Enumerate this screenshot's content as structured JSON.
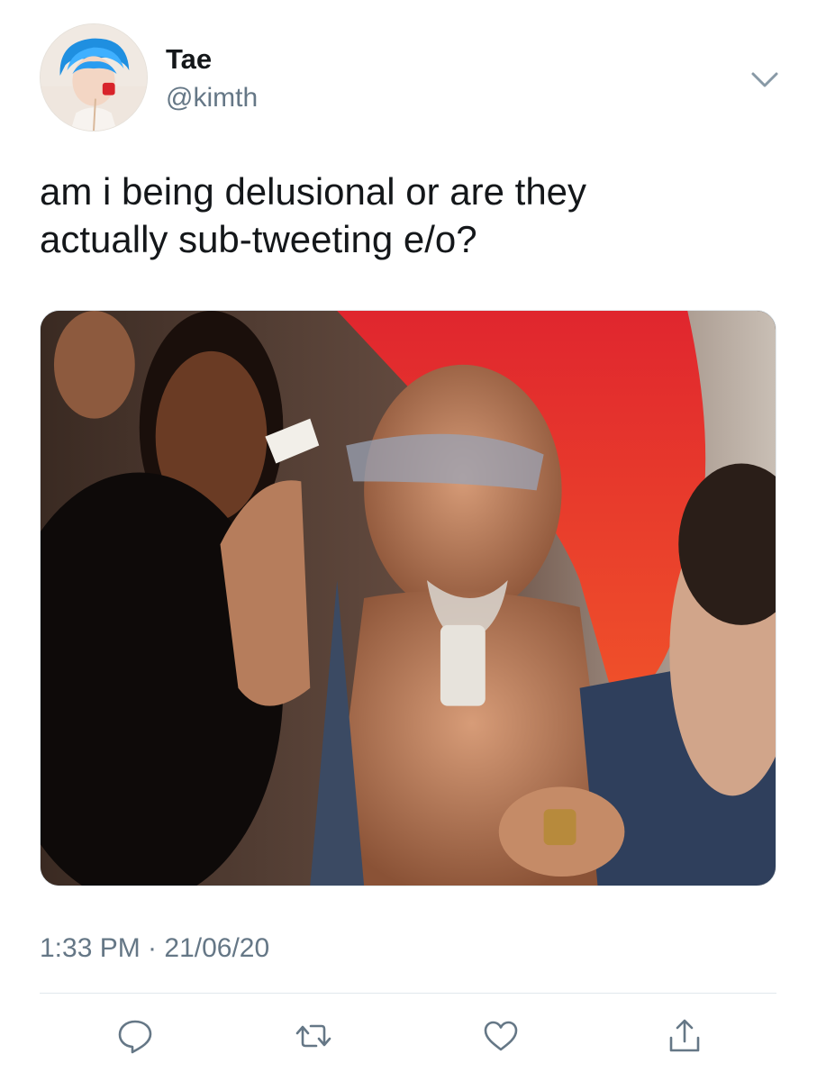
{
  "user": {
    "display_name": "Tae",
    "handle": "@kimth",
    "avatar_icon": "profile-photo"
  },
  "tweet": {
    "text_lines": [
      "am i being delusional or are they",
      "actually sub-tweeting e/o?"
    ],
    "timestamp": "1:33 PM · 21/06/20"
  },
  "actions": [
    {
      "name": "reply",
      "icon": "speech-bubble-icon"
    },
    {
      "name": "retweet",
      "icon": "retweet-arrows-icon"
    },
    {
      "name": "like",
      "icon": "heart-icon"
    },
    {
      "name": "share",
      "icon": "share-upload-icon"
    }
  ],
  "colors": {
    "text": "#14171a",
    "secondary": "#657786",
    "divider": "#e1e8ed",
    "icon": "#657786"
  }
}
